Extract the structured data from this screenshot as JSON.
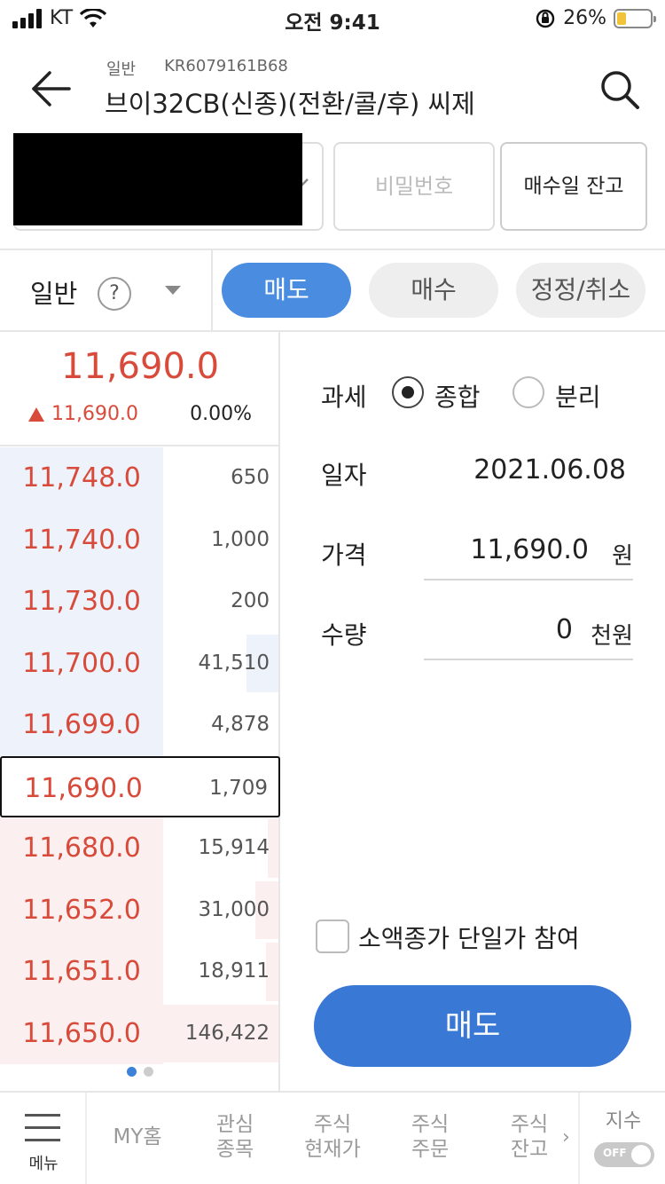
{
  "status_bar": {
    "carrier": "KT",
    "time": "오전 9:41",
    "battery": "26%"
  },
  "header": {
    "type": "일반",
    "code": "KR6079161B68",
    "title": "브이32CB(신종)(전환/콜/후)    씨제"
  },
  "account": {
    "password_placeholder": "비밀번호",
    "buy_balance_button": "매수일 잔고"
  },
  "mode": {
    "order_type": "일반",
    "help": "?",
    "tabs": [
      "매도",
      "매수",
      "정정/취소"
    ],
    "active_tab": "매도"
  },
  "book": {
    "current_price": "11,690.0",
    "change": "11,690.0",
    "change_rate": "0.00%",
    "rows": [
      {
        "price": "11,748.0",
        "qty": "650",
        "side": "ask"
      },
      {
        "price": "11,740.0",
        "qty": "1,000",
        "side": "ask"
      },
      {
        "price": "11,730.0",
        "qty": "200",
        "side": "ask"
      },
      {
        "price": "11,700.0",
        "qty": "41,510",
        "side": "ask"
      },
      {
        "price": "11,699.0",
        "qty": "4,878",
        "side": "ask"
      },
      {
        "price": "11,690.0",
        "qty": "1,709",
        "side": "bid",
        "selected": true
      },
      {
        "price": "11,680.0",
        "qty": "15,914",
        "side": "bid"
      },
      {
        "price": "11,652.0",
        "qty": "31,000",
        "side": "bid"
      },
      {
        "price": "11,651.0",
        "qty": "18,911",
        "side": "bid"
      },
      {
        "price": "11,650.0",
        "qty": "146,422",
        "side": "bid"
      }
    ]
  },
  "form": {
    "tax_label": "과세",
    "tax_options": [
      "종합",
      "분리"
    ],
    "tax_selected": "종합",
    "date_label": "일자",
    "date_value": "2021.06.08",
    "price_label": "가격",
    "price_value": "11,690.0",
    "price_unit": "원",
    "qty_label": "수량",
    "qty_value": "0",
    "qty_unit": "천원",
    "small_odd_label": "소액종가 단일가 참여",
    "submit_label": "매도"
  },
  "tabbar": {
    "menu": "메뉴",
    "tabs": [
      "MY홈",
      "관심\n종목",
      "주식\n현재가",
      "주식\n주문",
      "주식\n잔고"
    ],
    "more": "›",
    "index_label": "지수",
    "toggle_label": "OFF"
  },
  "colors": {
    "up": "#d84a3a",
    "accent": "#3a78d6",
    "ask_bg": "#eef2fb",
    "bid_bg": "#fcefef"
  }
}
